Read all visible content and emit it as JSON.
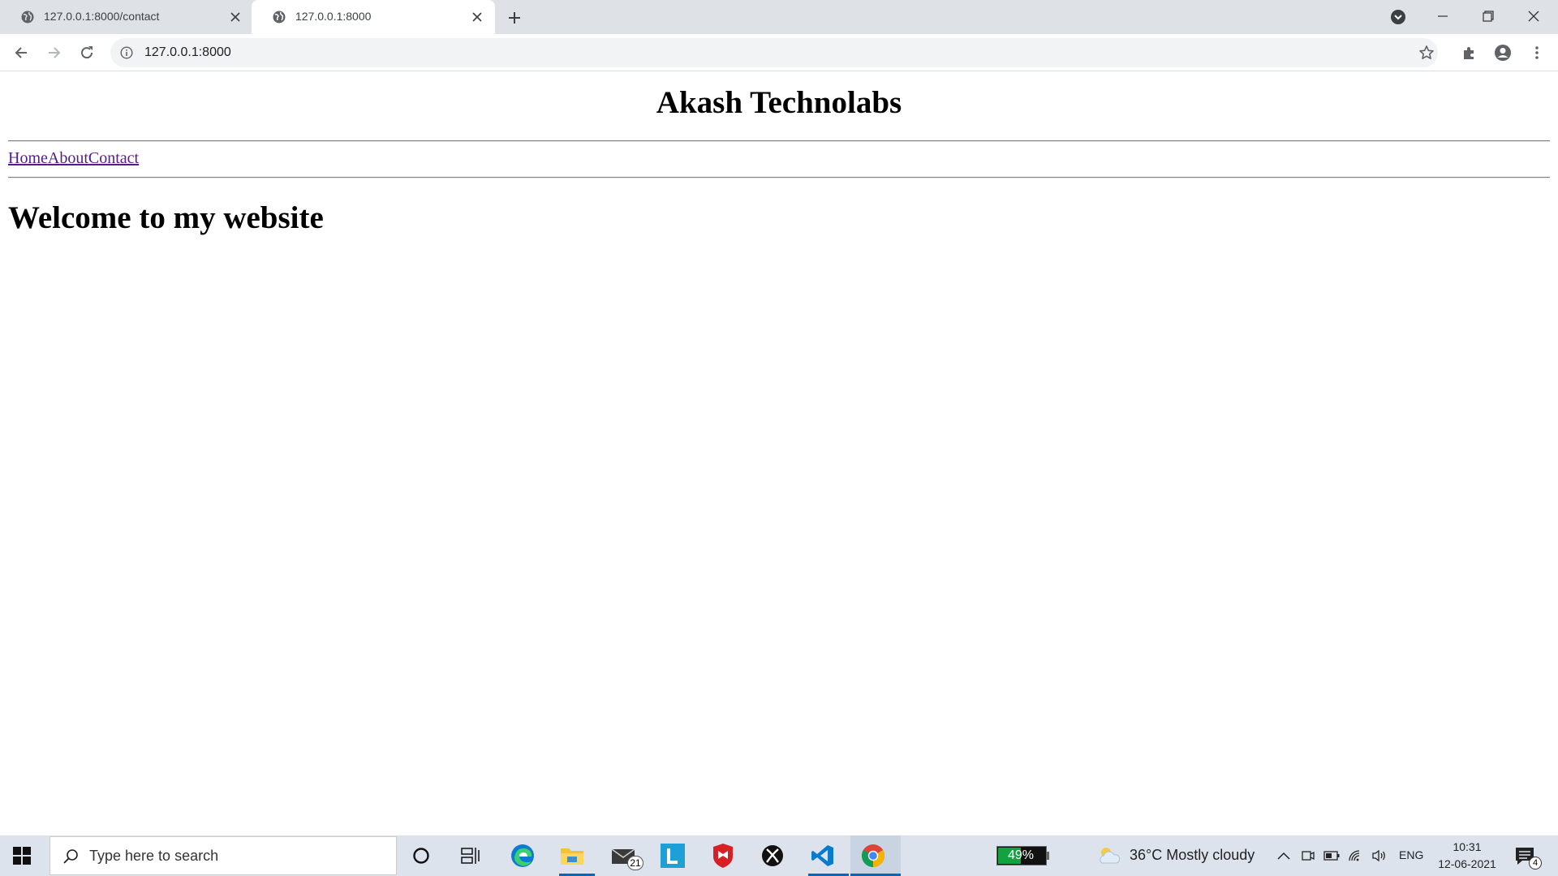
{
  "browser": {
    "tabs": [
      {
        "title": "127.0.0.1:8000/contact",
        "active": false
      },
      {
        "title": "127.0.0.1:8000",
        "active": true
      }
    ],
    "url": "127.0.0.1:8000"
  },
  "page": {
    "site_title": "Akash Technolabs",
    "nav": [
      {
        "label": "Home"
      },
      {
        "label": "About"
      },
      {
        "label": "Contact"
      }
    ],
    "heading": "Welcome to my website"
  },
  "taskbar": {
    "search_placeholder": "Type here to search",
    "mail_badge": "21",
    "battery_percent": "49%",
    "battery_level": 0.49,
    "weather": "36°C  Mostly cloudy",
    "language": "ENG",
    "time": "10:31",
    "date": "12-06-2021",
    "notification_count": "4",
    "colors": {
      "taskbar_bg": "#dde3ec",
      "accent": "#0067c0",
      "battery_green": "#12a340",
      "link_visited": "#551a8b"
    }
  }
}
